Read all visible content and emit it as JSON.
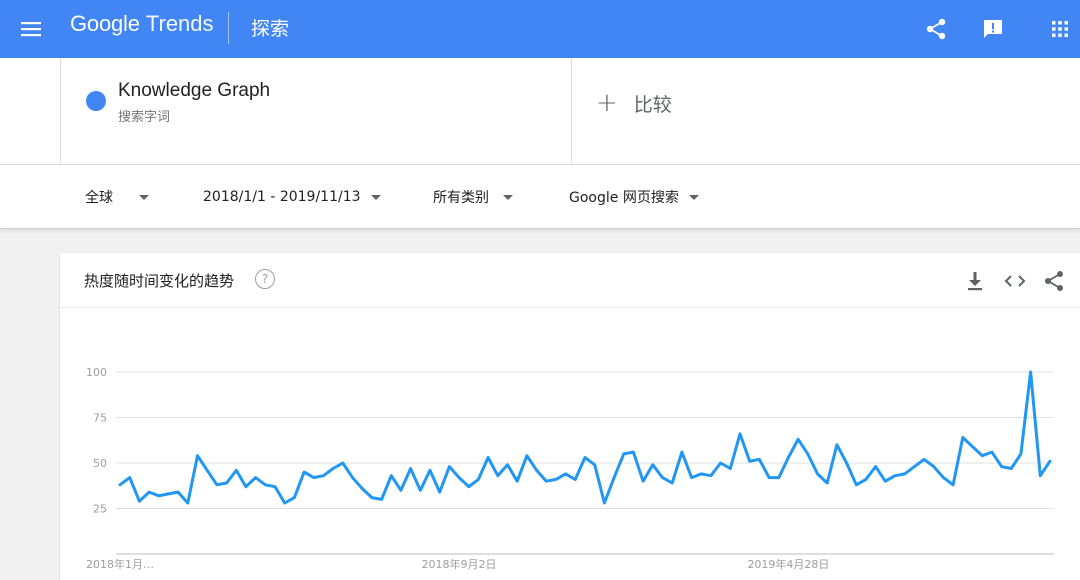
{
  "header": {
    "brand_google": "Google",
    "brand_trends": "Trends",
    "page_label": "探索",
    "icons": [
      "menu-icon",
      "share-icon",
      "feedback-icon",
      "apps-icon"
    ],
    "bar_color": "#4285f4"
  },
  "search_term": {
    "name": "Knowledge Graph",
    "type": "搜索字词",
    "color": "#4285f4"
  },
  "compare": {
    "plus": "+",
    "label": "比较"
  },
  "filters": {
    "region": "全球",
    "date_range": "2018/1/1 - 2019/11/13",
    "category": "所有类别",
    "search_type": "Google 网页搜索"
  },
  "card": {
    "title": "热度随时间变化的趋势",
    "help": "?",
    "actions": [
      "download-icon",
      "embed-icon",
      "share-icon"
    ]
  },
  "chart_data": {
    "type": "line",
    "title": "",
    "xlabel": "",
    "ylabel": "",
    "ylim": [
      0,
      100
    ],
    "yticks": [
      25,
      50,
      75,
      100
    ],
    "grid": true,
    "line_color": "#2196f3",
    "x_tick_labels": [
      "2018年1月…",
      "2018年9月2日",
      "2019年4月28日"
    ],
    "x_tick_indices": [
      0,
      35,
      69
    ],
    "series": [
      {
        "values": [
          38,
          42,
          29,
          34,
          32,
          33,
          34,
          28,
          54,
          46,
          38,
          39,
          46,
          37,
          42,
          38,
          37,
          28,
          31,
          45,
          42,
          43,
          47,
          50,
          42,
          36,
          31,
          30,
          43,
          35,
          47,
          35,
          46,
          34,
          48,
          42,
          37,
          41,
          53,
          43,
          49,
          40,
          54,
          46,
          40,
          41,
          44,
          41,
          53,
          49,
          28,
          42,
          55,
          56,
          40,
          49,
          42,
          39,
          56,
          42,
          44,
          43,
          50,
          47,
          66,
          51,
          52,
          42,
          42,
          53,
          63,
          55,
          44,
          39,
          60,
          50,
          38,
          41,
          48,
          40,
          43,
          44,
          48,
          52,
          48,
          42,
          38,
          64,
          59,
          54,
          56,
          48,
          47,
          55,
          100,
          43,
          51
        ]
      }
    ]
  }
}
